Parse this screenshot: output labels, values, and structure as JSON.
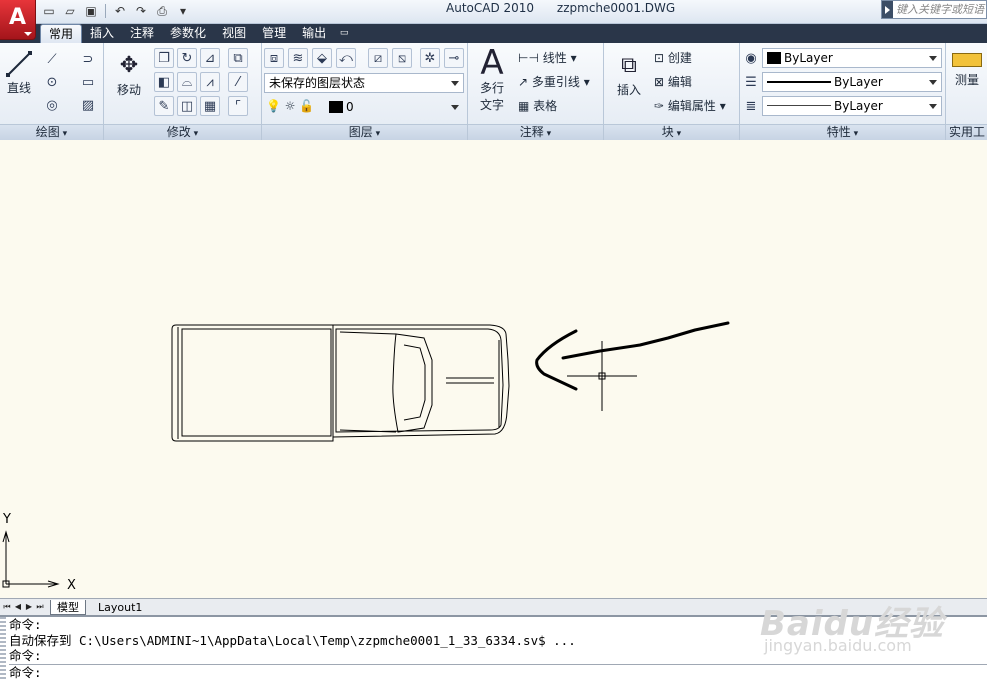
{
  "titlebar": {
    "app_button_icon": "autocad-logo-icon",
    "app_letter": "A",
    "title": "AutoCAD 2010      zzpmche0001.DWG",
    "search_placeholder": "键入关键字或短语",
    "qat_icons": [
      "new-icon",
      "open-icon",
      "save-icon",
      "undo-icon",
      "redo-icon",
      "plot-icon",
      "customize-icon"
    ]
  },
  "tabs": [
    "常用",
    "插入",
    "注释",
    "参数化",
    "视图",
    "管理",
    "输出"
  ],
  "active_tab": "常用",
  "ribbon": {
    "draw": {
      "title": "绘图",
      "line_label": "直线"
    },
    "modify": {
      "title": "修改",
      "move_label": "移动"
    },
    "layers": {
      "title": "图层",
      "layer_state": "未保存的图层状态",
      "current_layer": "0"
    },
    "annotation": {
      "title": "注释",
      "mtext_label_1": "多行",
      "mtext_label_2": "文字",
      "linear_label": "线性",
      "mleader_label": "多重引线",
      "table_label": "表格"
    },
    "block": {
      "title": "块",
      "insert_label": "插入",
      "create_label": "创建",
      "edit_label": "编辑",
      "edit_attr_label": "编辑属性"
    },
    "properties": {
      "title": "特性",
      "color": "ByLayer",
      "linetype": "ByLayer",
      "lineweight": "ByLayer"
    },
    "utilities": {
      "title": "实用工",
      "measure_label": "测量"
    }
  },
  "drawing": {
    "ucs_x": "X",
    "ucs_y": "Y",
    "background_color": "#fcfaef",
    "line_color": "#000000"
  },
  "layout_tabs": [
    "模型",
    "Layout1"
  ],
  "active_layout": "模型",
  "command_lines": [
    "命令:",
    "自动保存到 C:\\Users\\ADMINI~1\\AppData\\Local\\Temp\\zzpmche0001_1_33_6334.sv$ ...",
    "命令:"
  ],
  "command_prompt": "命令:",
  "watermark": {
    "logo": "Baidu经验",
    "url": "jingyan.baidu.com"
  }
}
